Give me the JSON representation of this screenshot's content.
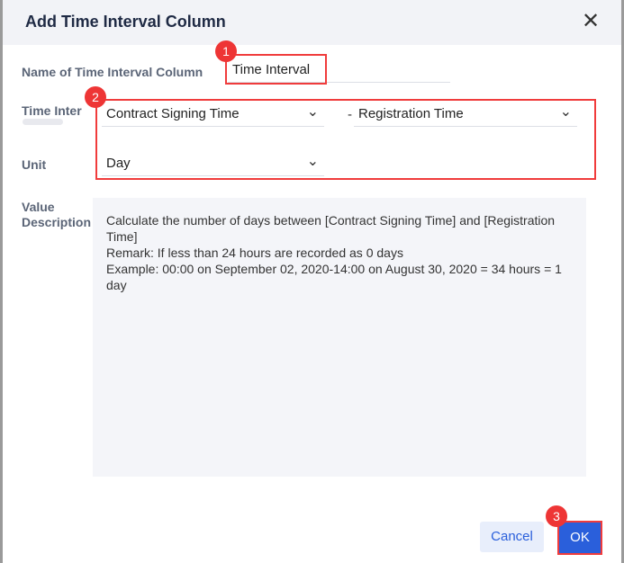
{
  "dialog": {
    "title": "Add Time Interval Column",
    "close_icon": "close-icon"
  },
  "form": {
    "name_label": "Name of Time Interval Column",
    "name_value": "Time Interval",
    "interval_label": "Time Inter",
    "start_field": "Contract Signing Time",
    "separator": "-",
    "end_field": "Registration Time",
    "unit_label": "Unit",
    "unit_value": "Day",
    "desc_label": "Value Description",
    "description": "Calculate the number of days between [Contract Signing Time] and [Registration Time]\nRemark: If less than 24 hours are recorded as 0 days\nExample: 00:00 on September 02, 2020-14:00 on August 30, 2020 = 34 hours = 1 day"
  },
  "annotations": [
    "1",
    "2",
    "3"
  ],
  "buttons": {
    "cancel": "Cancel",
    "ok": "OK"
  },
  "colors": {
    "primary": "#2a5fdb",
    "highlight": "#f03c3c"
  }
}
